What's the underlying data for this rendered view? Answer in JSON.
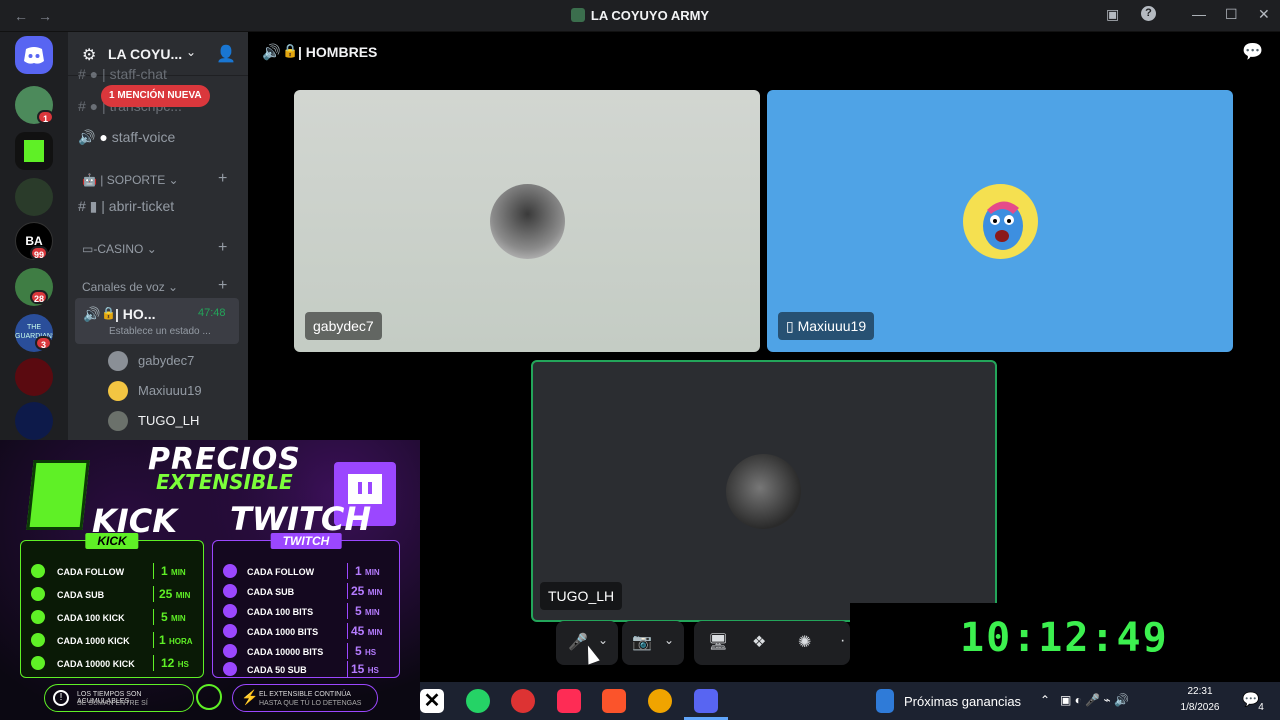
{
  "window": {
    "title": "LA COYUYO ARMY",
    "back": "←",
    "forward": "→",
    "inbox": "▣",
    "help": "?",
    "minimize": "—",
    "maximize": "☐",
    "close": "✕"
  },
  "servers": {
    "badges": [
      "1",
      "99",
      "28",
      "3"
    ],
    "labels": [
      "BA",
      "THE GUARDIANS"
    ]
  },
  "sidebar": {
    "guild_name": "LA COYU...",
    "mention_pill": "1 MENCIÓN NUEVA",
    "channels": {
      "staff_chat": "| staff-chat",
      "transcripts": "| transcripc...",
      "staff_voice": "staff-voice",
      "soporte_cat": "| SOPORTE",
      "abrir_ticket": "| abrir-ticket",
      "casino_cat": "-CASINO",
      "voice_cat": "Canales de voz",
      "hombres_short": "| HO...",
      "timer": "47:48",
      "status": "Establece un estado ..."
    },
    "voice_users": [
      "gabydec7",
      "Maxiuuu19",
      "TUGO_LH"
    ]
  },
  "main": {
    "channel_title": "| HOMBRES",
    "tiles": [
      {
        "name": "gabydec7"
      },
      {
        "name": "Maxiuuu19"
      },
      {
        "name": "TUGO_LH"
      }
    ]
  },
  "clock": "10:12:49",
  "overlay": {
    "precios": "PRECIOS",
    "extensible": "EXTENSIBLE",
    "kick_logo": "KICK",
    "twitch_logo": "TWITCH",
    "kick_header": "KICK",
    "twitch_header": "TWITCH",
    "kick_rows": [
      {
        "label": "CADA FOLLOW",
        "value": "1",
        "unit": "MIN"
      },
      {
        "label": "CADA SUB",
        "value": "25",
        "unit": "MIN"
      },
      {
        "label": "CADA 100 KICK",
        "value": "5",
        "unit": "MIN"
      },
      {
        "label": "CADA 1000 KICK",
        "value": "1",
        "unit": "HORA"
      },
      {
        "label": "CADA 10000 KICK",
        "value": "12",
        "unit": "HS"
      }
    ],
    "twitch_rows": [
      {
        "label": "CADA FOLLOW",
        "value": "1",
        "unit": "MIN"
      },
      {
        "label": "CADA SUB",
        "value": "25",
        "unit": "MIN"
      },
      {
        "label": "CADA 100 BITS",
        "value": "5",
        "unit": "MIN"
      },
      {
        "label": "CADA 1000 BITS",
        "value": "45",
        "unit": "MIN"
      },
      {
        "label": "CADA 10000 BITS",
        "value": "5",
        "unit": "HS"
      },
      {
        "label": "CADA 50 SUB",
        "value": "15",
        "unit": "HS"
      }
    ],
    "foot_left_1": "LOS TIEMPOS SON ACUMULABLES",
    "foot_left_2": "SE SUMAN ENTRE SÍ",
    "foot_right_1": "EL EXTENSIBLE CONTINÚA",
    "foot_right_2": "HASTA QUE TÚ LO DETENGAS"
  },
  "taskbar": {
    "weather_text": "Próximas ganancias",
    "time": "22:31",
    "date": "1/8/2026",
    "notif_count": "4"
  },
  "colors": {
    "kick_green": "#5ff026",
    "twitch_purple": "#9b47ff",
    "discord_green": "#23a55a",
    "clock_green": "#3cf04f",
    "mention_red": "#da373c"
  }
}
